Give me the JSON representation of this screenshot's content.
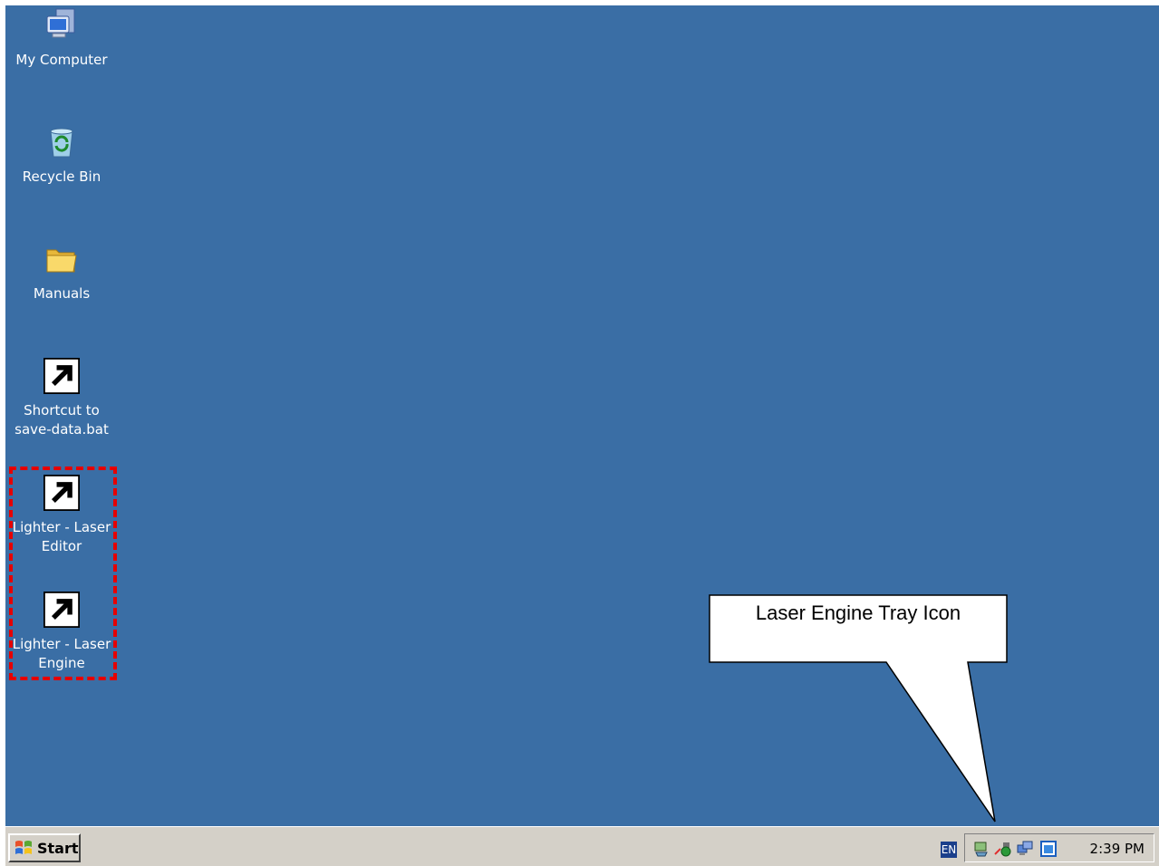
{
  "desktop": {
    "icons": [
      {
        "label": "My Computer",
        "icon": "my-computer-icon"
      },
      {
        "label": "Recycle Bin",
        "icon": "recycle-bin-icon"
      },
      {
        "label": "Manuals",
        "icon": "folder-icon"
      },
      {
        "label": "Shortcut to\nsave-data.bat",
        "icon": "batch-file-shortcut-icon"
      },
      {
        "label": "Lighter - Laser\nEditor",
        "icon": "laser-editor-quill-icon"
      },
      {
        "label": "Lighter - Laser\nEngine",
        "icon": "laser-engine-icon"
      }
    ],
    "background_color": "#3a6ea5"
  },
  "annotation": {
    "callout_text": "Laser Engine Tray Icon",
    "highlight_color": "#e60000"
  },
  "taskbar": {
    "start_label": "Start",
    "language": "EN",
    "tray_icons": [
      "network-icon",
      "laser-engine-tray-icon",
      "computers-icon",
      "app-window-icon"
    ],
    "clock": "2:39 PM"
  }
}
